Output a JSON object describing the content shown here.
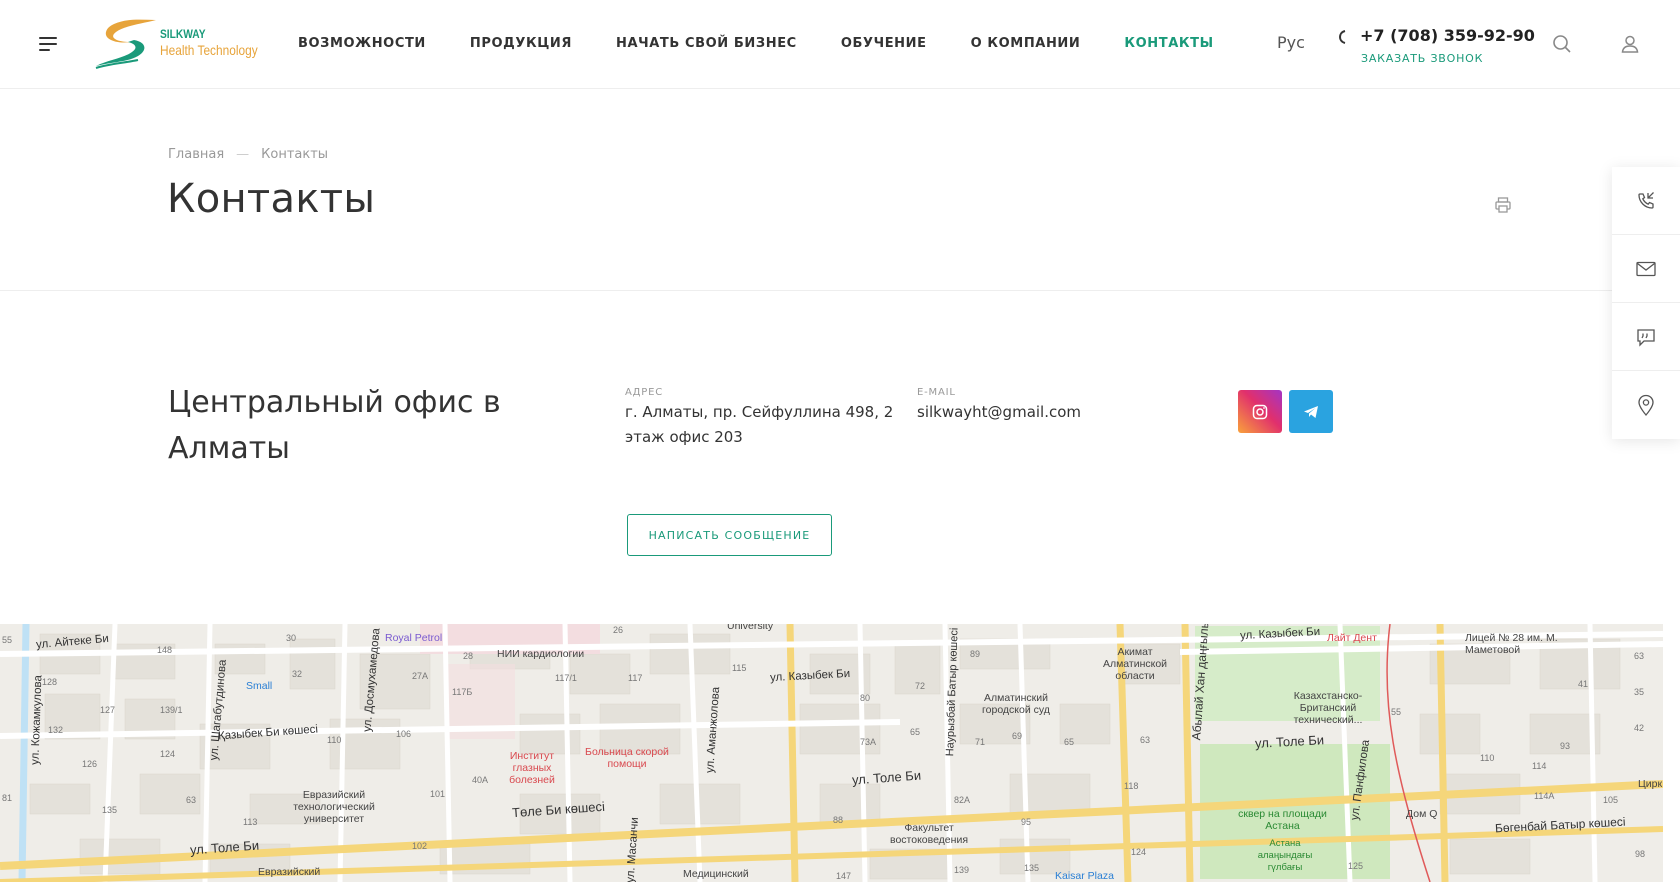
{
  "header": {
    "logo": {
      "line1": "SILKWAY",
      "line2": "Health Technology"
    },
    "nav": [
      {
        "label": "ВОЗМОЖНОСТИ",
        "active": false
      },
      {
        "label": "ПРОДУКЦИЯ",
        "active": false
      },
      {
        "label": "НАЧАТЬ СВОЙ БИЗНЕС",
        "active": false
      },
      {
        "label": "ОБУЧЕНИЕ",
        "active": false
      },
      {
        "label": "О КОМПАНИИ",
        "active": false
      },
      {
        "label": "КОНТАКТЫ",
        "active": true
      }
    ],
    "language": "Рус",
    "phone": "+7 (708) 359-92-90",
    "callback": "ЗАКАЗАТЬ ЗВОНОК",
    "icons": [
      "burger-menu-icon",
      "search-icon",
      "user-icon",
      "phone-icon"
    ]
  },
  "page": {
    "breadcrumb": {
      "home": "Главная",
      "separator": "—",
      "current": "Контакты"
    },
    "title": "Контакты"
  },
  "office": {
    "title": "Центральный офис в Алматы",
    "address_label": "АДРЕС",
    "address_value": "г. Алматы, пр. Сейфуллина 498, 2 этаж офис 203",
    "email_label": "E-MAIL",
    "email_value": "silkwayht@gmail.com",
    "socials": [
      "instagram-icon",
      "telegram-icon"
    ],
    "write_button": "НАПИСАТЬ СООБЩЕНИЕ"
  },
  "side_panel": [
    "callback-phone-icon",
    "mail-icon",
    "chat-icon",
    "location-pin-icon"
  ],
  "map": {
    "streets": [
      "ул. Айтеке Би",
      "ул. Кожамкулова",
      "ул. Шагабутдинова",
      "Қазыбек Би көшесі",
      "ул. Досмухамедова",
      "ул. Толе Би",
      "Төле Би көшесі",
      "ул. Казыбек Би",
      "ул. Аманжолова",
      "ул. Масанчи",
      "ул. Толе Би",
      "ул. Толе Би",
      "Бөгенбай Батыр көшесі",
      "ул. Казыбек Би",
      "ул. Панфилова",
      "Абылай Хан даңғылы",
      "Наурызбай Батыр көшесі"
    ],
    "places": [
      "Royal Petrol",
      "НИИ кардиологии",
      "Small",
      "Институт глазных болезней",
      "Больница скорой помощи",
      "Евразийский технологический университет",
      "Акимат Алматинской области",
      "Алматинский городской суд",
      "Факультет востоковедения",
      "Лайт Дент",
      "Лицей № 28 им. М. Маметовой",
      "Казахстанско-Британский технический...",
      "сквер на площади Астана",
      "Астана алаңындағы гүлбағы",
      "Дом Q",
      "Kaisar Plaza",
      "Медицинский",
      "University",
      "Евразийский",
      "Цирк"
    ],
    "numbers": [
      "55",
      "148",
      "30",
      "28",
      "26",
      "89",
      "128",
      "127",
      "139/1",
      "32",
      "27А",
      "117/1",
      "117",
      "115",
      "80",
      "72",
      "132",
      "110",
      "106",
      "117Б",
      "65",
      "71",
      "69",
      "65",
      "63",
      "126",
      "124",
      "40А",
      "101",
      "73А",
      "118",
      "135",
      "113",
      "63",
      "102",
      "88",
      "82А",
      "95",
      "124",
      "139",
      "135",
      "125",
      "147",
      "41",
      "35",
      "63",
      "42",
      "93",
      "110",
      "114",
      "114А",
      "105",
      "98",
      "81",
      "55"
    ]
  }
}
